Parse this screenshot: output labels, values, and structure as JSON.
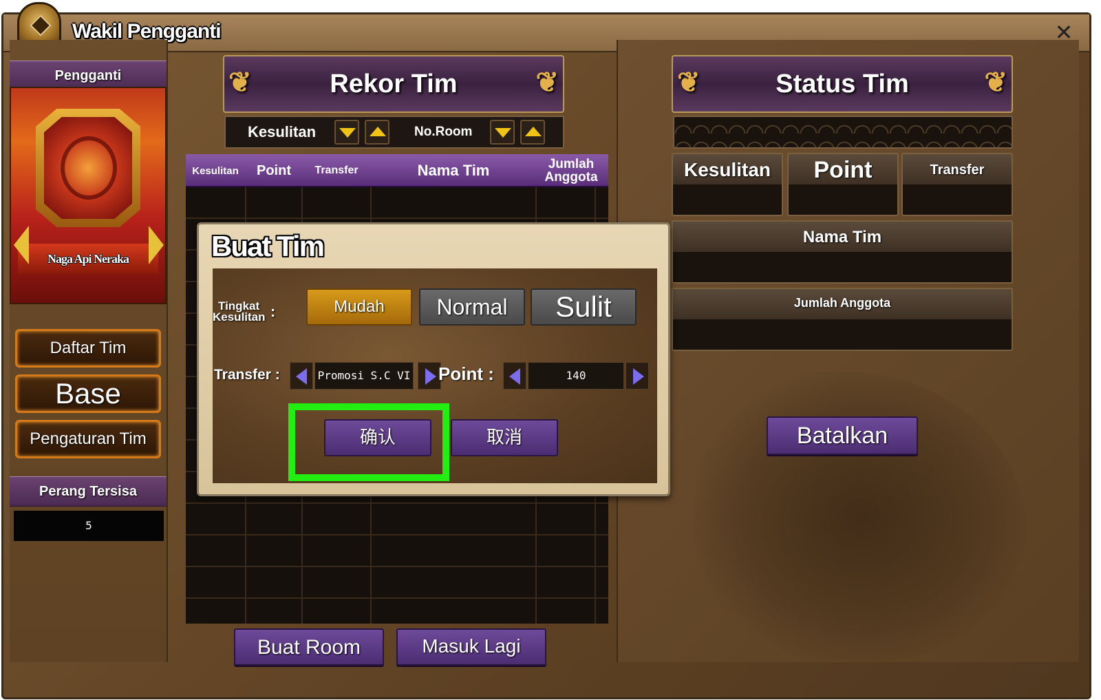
{
  "window": {
    "title": "Wakil Pengganti",
    "close_icon": "close-icon"
  },
  "left": {
    "header": "Pengganti",
    "portrait_name": "Naga Api Neraka",
    "buttons": [
      "Daftar Tim",
      "Base",
      "Pengaturan Tim"
    ],
    "remaining_label": "Perang Tersisa",
    "remaining_value": "5"
  },
  "record": {
    "title": "Rekor Tim",
    "sort": {
      "difficulty_label": "Kesulitan",
      "room_label": "No.Room"
    },
    "columns": [
      "Kesulitan",
      "Point",
      "Transfer",
      "Nama Tim",
      "Jumlah\nAnggota"
    ],
    "create_room": "Buat Room",
    "rejoin": "Masuk Lagi"
  },
  "status": {
    "title": "Status Tim",
    "fields": {
      "difficulty": "Kesulitan",
      "point": "Point",
      "transfer": "Transfer",
      "team_name": "Nama Tim",
      "member_count": "Jumlah Anggota"
    },
    "cancel": "Batalkan"
  },
  "dialog": {
    "title": "Buat Tim",
    "difficulty_label_1": "Tingkat",
    "difficulty_label_2": "Kesulitan",
    "difficulty_options": [
      "Mudah",
      "Normal",
      "Sulit"
    ],
    "difficulty_selected": "Mudah",
    "transfer_label": "Transfer",
    "transfer_value": "Promosi S.C VI",
    "point_label": "Point",
    "point_value": "140",
    "confirm": "确认",
    "cancel": "取消"
  },
  "colors": {
    "highlight": "#22ee11",
    "button_purple": "#5a3a84",
    "button_orange_border": "#d47a1a",
    "selected_difficulty": "#c8860f"
  }
}
